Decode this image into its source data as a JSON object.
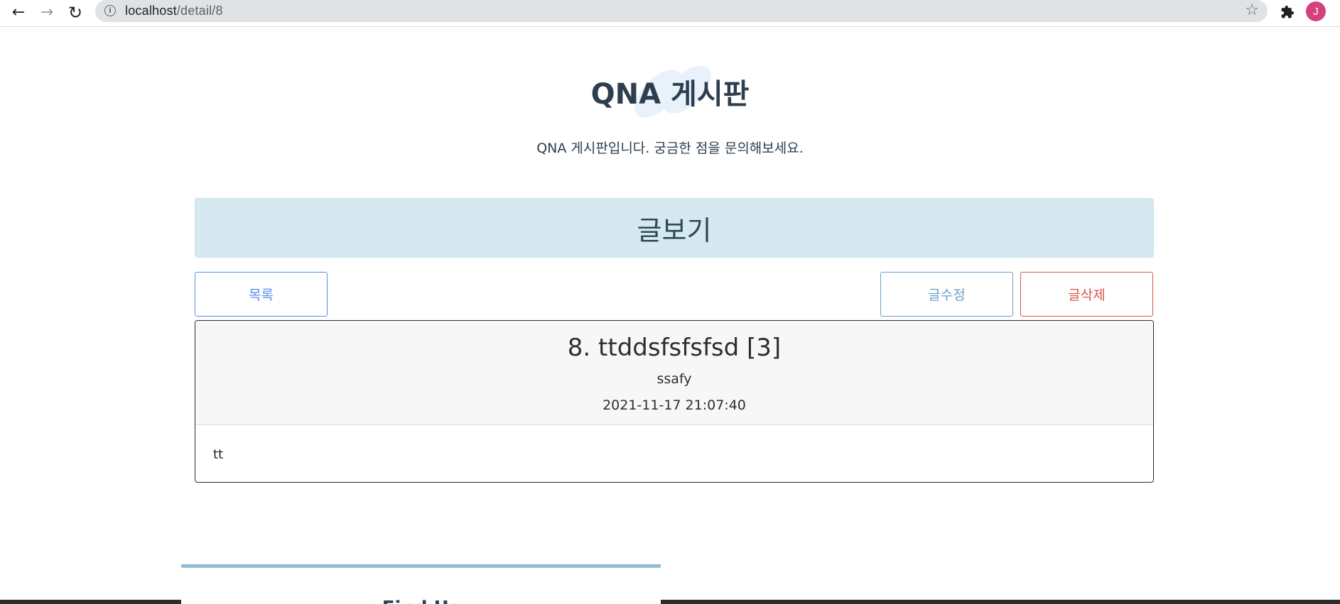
{
  "browser": {
    "back_icon": "arrow-left-icon",
    "forward_icon": "arrow-right-icon",
    "reload_icon": "reload-icon",
    "url_host": "localhost",
    "url_path": "/detail/8",
    "info_icon": "info-icon",
    "bookmark_icon": "star-icon",
    "extensions_icon": "puzzle-icon",
    "profile_initial": "J",
    "profile_color": "#d3427d"
  },
  "header": {
    "title": "QNA 게시판",
    "subtitle": "QNA 게시판입니다. 궁금한 점을 문의해보세요."
  },
  "section": {
    "title": "글보기"
  },
  "actions": {
    "list_label": "목록",
    "edit_label": "글수정",
    "delete_label": "글삭제"
  },
  "article": {
    "title": "8. ttddsfsfsfsd [3]",
    "author": "ssafy",
    "date": "2021-11-17 21:07:40",
    "content": "tt"
  },
  "footer": {
    "tab_label": "Find Us"
  },
  "colors": {
    "primary_text": "#2c3e50",
    "banner_bg": "#d6e9f0",
    "list_button": "#5b8cf0",
    "edit_button": "#6aa0c4",
    "delete_button": "#d9534f"
  }
}
